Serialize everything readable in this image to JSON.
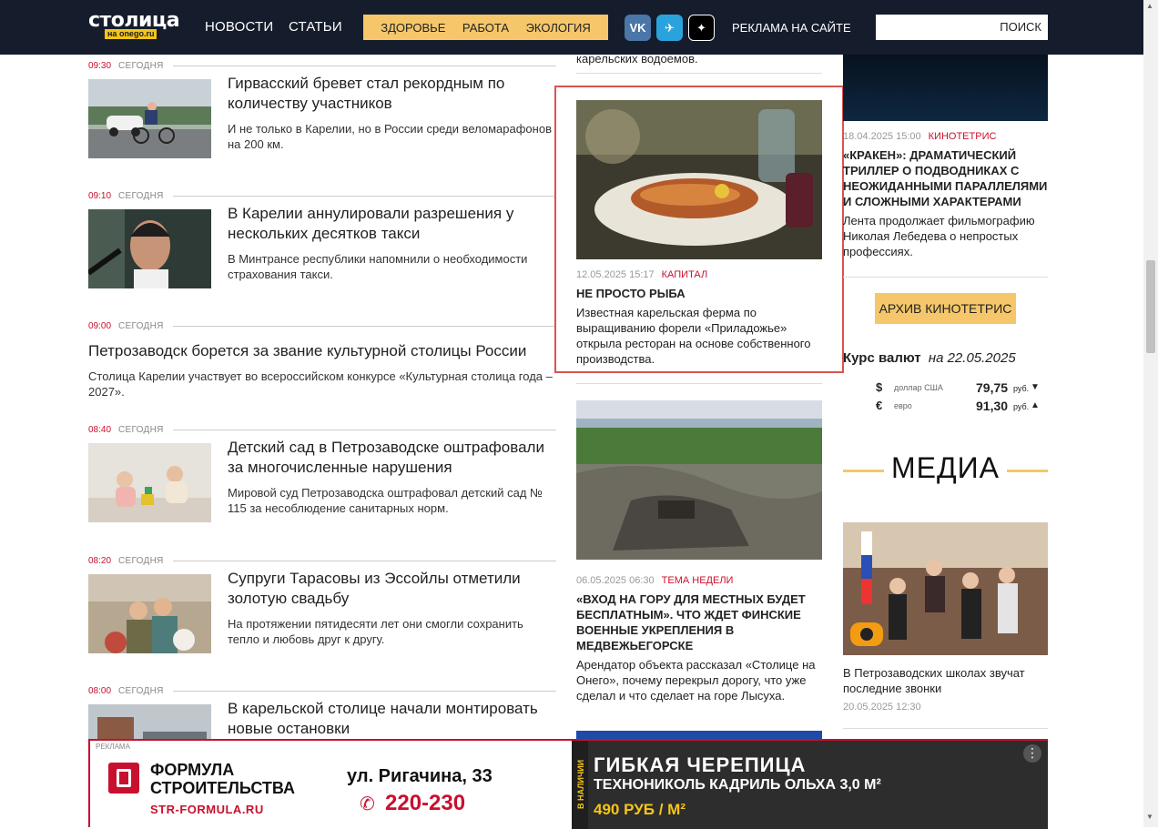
{
  "header": {
    "logo_main": "столица",
    "logo_sub": "на onego.ru",
    "nav": [
      "НОВОСТИ",
      "СТАТЬИ"
    ],
    "nav_yellow": [
      "ЗДОРОВЬЕ",
      "РАБОТА",
      "ЭКОЛОГИЯ"
    ],
    "social": [
      {
        "icon": "vk-icon",
        "label": "VK",
        "color": "#4a76a8"
      },
      {
        "icon": "telegram-icon",
        "label": "✈",
        "color": "#2aa3dd"
      },
      {
        "icon": "dzen-icon",
        "label": "✦",
        "color": "#000000"
      }
    ],
    "ad_link": "РЕКЛАМА НА САЙТЕ",
    "search_placeholder": "",
    "search_button": "ПОИСК"
  },
  "feed": [
    {
      "time": "09:30",
      "day": "СЕГОДНЯ",
      "title": "Гирвасский бревет стал рекордным по количеству участников",
      "desc": "И не только в Карелии, но в России среди веломарафонов на 200 км.",
      "thumb": "cyclist"
    },
    {
      "time": "09:10",
      "day": "СЕГОДНЯ",
      "title": "В Карелии аннулировали разрешения у нескольких десятков такси",
      "desc": "В Минтрансе республики напомнили о необходимости страхования такси.",
      "thumb": "driver"
    },
    {
      "time": "09:00",
      "day": "СЕГОДНЯ",
      "title": "Петрозаводск борется за звание культурной столицы России",
      "desc": "Столица Карелии участвует во всероссийском конкурсе «Культурная столица года – 2027».",
      "thumb": ""
    },
    {
      "time": "08:40",
      "day": "СЕГОДНЯ",
      "title": "Детский сад в Петрозаводске оштрафовали за многочисленные нарушения",
      "desc": "Мировой суд Петрозаводска оштрафовал детский сад № 115 за несоблюдение санитарных норм.",
      "thumb": "kids"
    },
    {
      "time": "08:20",
      "day": "СЕГОДНЯ",
      "title": "Супруги Тарасовы из Эссойлы отметили золотую свадьбу",
      "desc": "На протяжении пятидесяти лет они смогли сохранить тепло и любовь друг к другу.",
      "thumb": "couple"
    },
    {
      "time": "08:00",
      "day": "СЕГОДНЯ",
      "title": "В карельской столице начали монтировать новые остановки",
      "desc": "",
      "thumb": "stop"
    }
  ],
  "middle": {
    "top_fragment": "карельских водоемов.",
    "cards": [
      {
        "date": "12.05.2025 15:17",
        "rubric": "КАПИТАЛ",
        "title": "НЕ ПРОСТО РЫБА",
        "desc": "Известная карельская ферма по выращиванию форели «Приладожье» открыла ресторан на основе собственного производства."
      },
      {
        "date": "06.05.2025 06:30",
        "rubric": "ТЕМА НЕДЕЛИ",
        "title": "«ВХОД НА ГОРУ ДЛЯ МЕСТНЫХ БУДЕТ БЕСПЛАТНЫМ». ЧТО ЖДЕТ ФИНСКИЕ ВОЕННЫЕ УКРЕПЛЕНИЯ В МЕДВЕЖЬЕГОРСКЕ",
        "desc": "Арендатор объекта рассказал «Столице на Онего», почему перекрыл дорогу, что уже сделал и что сделает на горе Лысуха."
      }
    ]
  },
  "right": {
    "kino_date": "18.04.2025 15:00",
    "kino_rubric": "КИНОТЕТРИС",
    "kino_title": "«КРАКЕН»: ДРАМАТИЧЕСКИЙ ТРИЛЛЕР О ПОДВОДНИКАХ С НЕОЖИДАННЫМИ ПАРАЛЛЕЛЯМИ И СЛОЖНЫМИ ХАРАКТЕРАМИ",
    "kino_desc": "Лента продолжает фильмографию Николая Лебедева о непростых профессиях.",
    "archive_btn": "АРХИВ КИНОТЕТРИС",
    "currency_title": "Курс валют",
    "currency_date": "на 22.05.2025",
    "currencies": [
      {
        "sym": "$",
        "name": "доллар США",
        "value": "79,75",
        "unit": "руб.",
        "trend": "▼"
      },
      {
        "sym": "€",
        "name": "евро",
        "value": "91,30",
        "unit": "руб.",
        "trend": "▲"
      }
    ],
    "media_heading": "МЕДИА",
    "media_title": "В Петрозаводских школах звучат последние звонки",
    "media_date": "20.05.2025 12:30"
  },
  "banner": {
    "label": "РЕКЛАМА",
    "brand_line1": "ФОРМУЛА",
    "brand_line2": "СТРОИТЕЛЬСТВА",
    "site": "STR-FORMULA.RU",
    "address": "ул. Ригачина, 33",
    "phone": "220-230",
    "product1": "ГИБКАЯ ЧЕРЕПИЦА",
    "product2": "ТЕХНОНИКОЛЬ КАДРИЛЬ ОЛЬХА 3,0 М²",
    "price": "490 РУБ / М²",
    "stock": "В НАЛИЧИИ"
  }
}
